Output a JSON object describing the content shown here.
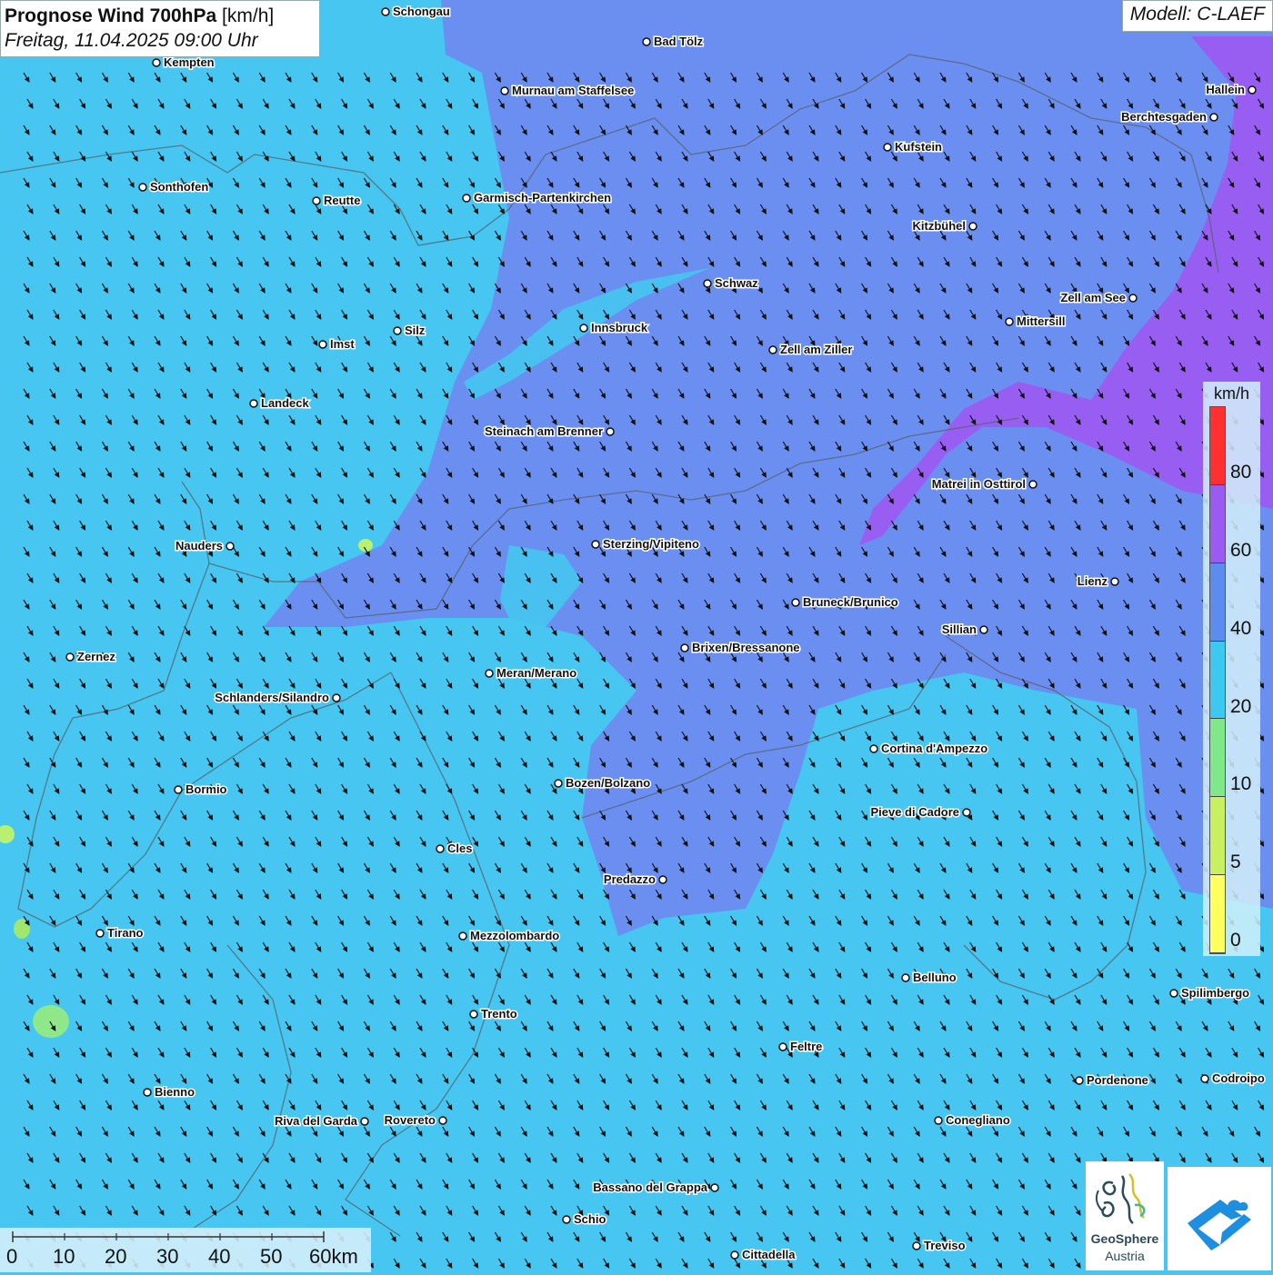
{
  "header": {
    "title_bold": "Prognose Wind 700hPa",
    "title_unit": "[km/h]",
    "datetime": "Freitag, 11.04.2025 09:00 Uhr",
    "model": "Modell: C-LAEF"
  },
  "legend": {
    "unit": "km/h",
    "ticks": [
      "80",
      "60",
      "40",
      "20",
      "10",
      "5",
      "0"
    ],
    "colors": [
      "#ff3030",
      "#9a5cf0",
      "#5d8cf0",
      "#3cc8f0",
      "#7ee88a",
      "#c8f060",
      "#ffff60"
    ]
  },
  "scale_bar": {
    "labels": [
      "0",
      "10",
      "20",
      "30",
      "40",
      "50",
      "60km"
    ]
  },
  "logos": {
    "geosphere_line1": "GeoSphere",
    "geosphere_line2": "Austria",
    "geosphere_icon": "geosphere-swirl-icon",
    "partner_icon": "mountain-cloud-icon"
  },
  "wind": {
    "direction": "from north-west",
    "arrow_icon": "wind-arrow-icon"
  },
  "cities": [
    {
      "name": "Schongau"
    },
    {
      "name": "Bad Tölz"
    },
    {
      "name": "Kempten"
    },
    {
      "name": "Murnau am Staffelsee"
    },
    {
      "name": "Hallein"
    },
    {
      "name": "Berchtesgaden"
    },
    {
      "name": "Kufstein"
    },
    {
      "name": "Sonthofen"
    },
    {
      "name": "Reutte"
    },
    {
      "name": "Garmisch-Partenkirchen"
    },
    {
      "name": "Kitzbühel"
    },
    {
      "name": "Schwaz"
    },
    {
      "name": "Zell am See"
    },
    {
      "name": "Silz"
    },
    {
      "name": "Innsbruck"
    },
    {
      "name": "Mittersill"
    },
    {
      "name": "Imst"
    },
    {
      "name": "Zell am Ziller"
    },
    {
      "name": "Landeck"
    },
    {
      "name": "Steinach am Brenner"
    },
    {
      "name": "Matrei in Osttirol"
    },
    {
      "name": "Nauders"
    },
    {
      "name": "Sterzing/Vipiteno"
    },
    {
      "name": "Lienz"
    },
    {
      "name": "Bruneck/Brunico"
    },
    {
      "name": "Sillian"
    },
    {
      "name": "Zernez"
    },
    {
      "name": "Brixen/Bressanone"
    },
    {
      "name": "Meran/Merano"
    },
    {
      "name": "Schlanders/Silandro"
    },
    {
      "name": "Cortina d'Ampezzo"
    },
    {
      "name": "Bozen/Bolzano"
    },
    {
      "name": "Bormio"
    },
    {
      "name": "Pieve di Cadore"
    },
    {
      "name": "Cles"
    },
    {
      "name": "Predazzo"
    },
    {
      "name": "Tirano"
    },
    {
      "name": "Mezzolombardo"
    },
    {
      "name": "Belluno"
    },
    {
      "name": "Spilimbergo"
    },
    {
      "name": "Trento"
    },
    {
      "name": "Feltre"
    },
    {
      "name": "Pordenone"
    },
    {
      "name": "Codroipo"
    },
    {
      "name": "Bienno"
    },
    {
      "name": "Riva del Garda"
    },
    {
      "name": "Rovereto"
    },
    {
      "name": "Conegliano"
    },
    {
      "name": "Bassano del Grappa"
    },
    {
      "name": "Schio"
    },
    {
      "name": "Treviso"
    },
    {
      "name": "Cittadella"
    }
  ]
}
